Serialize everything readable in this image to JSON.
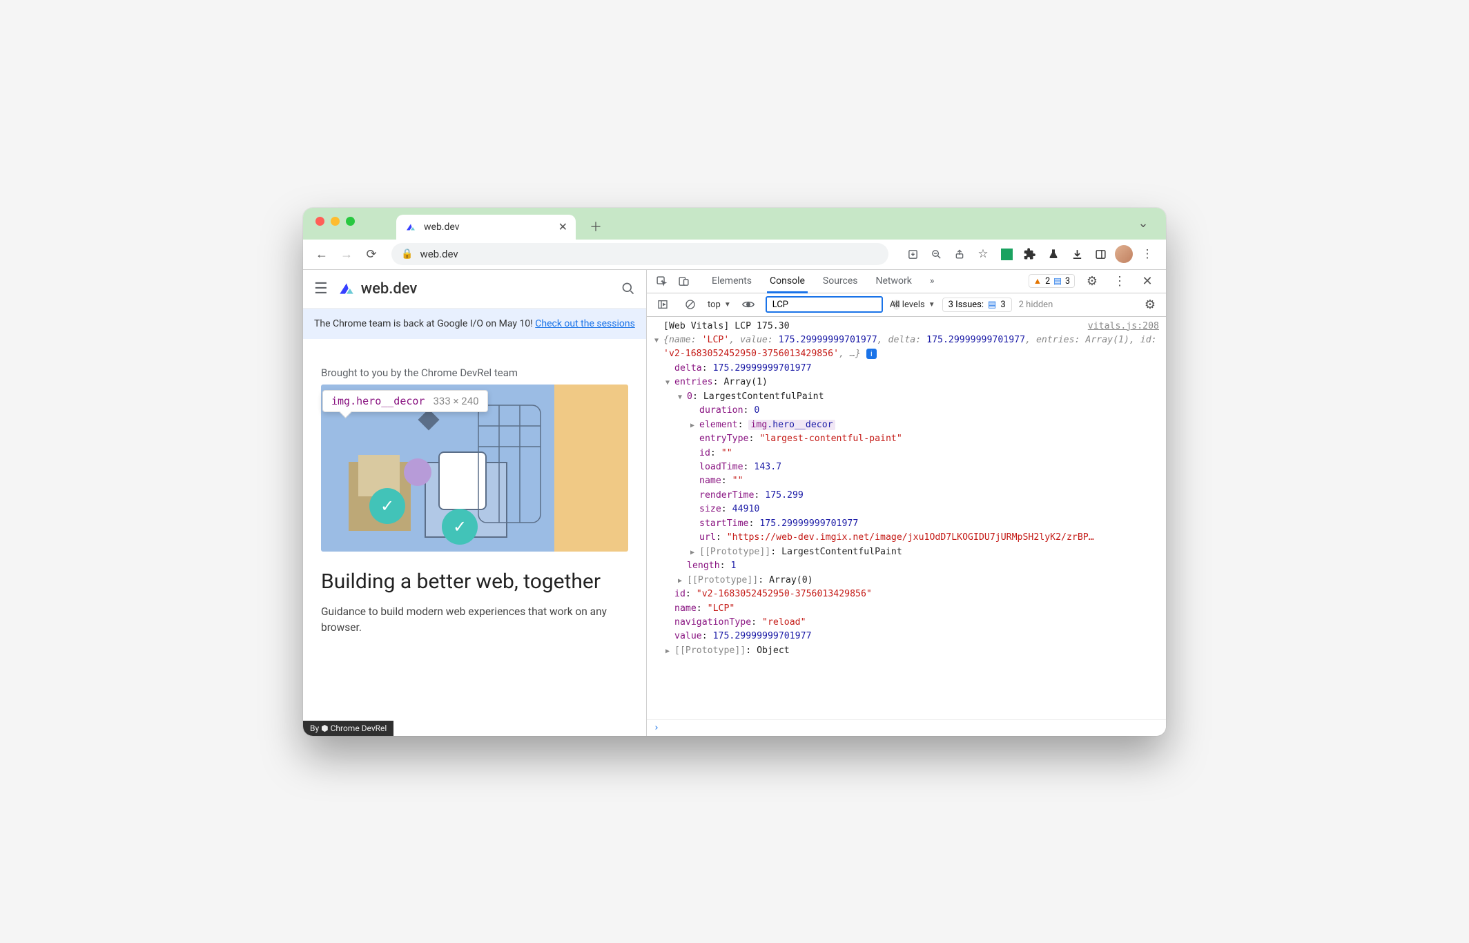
{
  "browser": {
    "tab_title": "web.dev",
    "url": "web.dev"
  },
  "page": {
    "brand": "web.dev",
    "banner_text": "The Chrome team is back at Google I/O on May 10! ",
    "banner_link": "Check out the sessions",
    "subtitle": "Brought to you by the Chrome DevRel team",
    "tooltip_selector": "img.hero__decor",
    "tooltip_dims": "333 × 240",
    "h1": "Building a better web, together",
    "lead": "Guidance to build modern web experiences that work on any browser.",
    "badge": "By ⬢ Chrome DevRel"
  },
  "devtools": {
    "tabs": [
      "Elements",
      "Console",
      "Sources",
      "Network"
    ],
    "active_tab": "Console",
    "overflow": "»",
    "warn_count": "2",
    "msg_count": "3",
    "context": "top",
    "filter_value": "LCP",
    "levels": "All levels",
    "issues_label": "3 Issues:",
    "issues_count": "3",
    "hidden": "2 hidden"
  },
  "log": {
    "header": "[Web Vitals] LCP 175.30",
    "source": "vitals.js:208",
    "summary_prefix": "{name: ",
    "summary_name": "'LCP'",
    "summary_value_lbl": ", value: ",
    "summary_value": "175.29999999701977",
    "summary_delta_lbl": ", delta: ",
    "summary_delta": "175.29999999701977",
    "summary_entries_lbl": ", entries: Array(1), id: ",
    "summary_id": "'v2-1683052452950-3756013429856'",
    "summary_end": ", …}",
    "delta": "175.29999999701977",
    "entries_label": "Array(1)",
    "entry0_type": "LargestContentfulPaint",
    "duration": "0",
    "element_tag": "img",
    "element_class": ".hero__decor",
    "entryType": "\"largest-contentful-paint\"",
    "id_empty": "\"\"",
    "loadTime": "143.7",
    "name_empty": "\"\"",
    "renderTime": "175.299",
    "size": "44910",
    "startTime": "175.29999999701977",
    "url": "\"https://web-dev.imgix.net/image/jxu1OdD7LKOGIDU7jURMpSH2lyK2/zrBP…",
    "proto_entry": "LargestContentfulPaint",
    "length": "1",
    "proto_arr": "Array(0)",
    "obj_id": "\"v2-1683052452950-3756013429856\"",
    "obj_name": "\"LCP\"",
    "navigationType": "\"reload\"",
    "obj_value": "175.29999999701977",
    "proto_obj": "Object"
  }
}
